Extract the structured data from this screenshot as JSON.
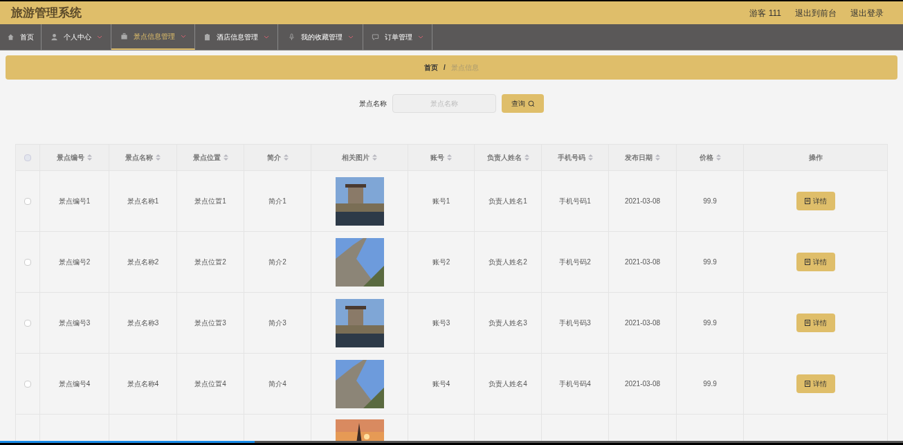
{
  "header": {
    "title": "旅游管理系统",
    "user": "游客 111",
    "links": [
      "退出到前台",
      "退出登录"
    ]
  },
  "nav": [
    {
      "label": "首页",
      "selected": false
    },
    {
      "label": "个人中心",
      "selected": false
    },
    {
      "label": "景点信息管理",
      "selected": true
    },
    {
      "label": "酒店信息管理",
      "selected": false
    },
    {
      "label": "我的收藏管理",
      "selected": false
    },
    {
      "label": "订单管理",
      "selected": false
    }
  ],
  "breadcrumb": {
    "items": [
      "首页",
      "景点信息"
    ],
    "separator": "/"
  },
  "search": {
    "label": "景点名称",
    "placeholder": "景点名称",
    "button": "查询"
  },
  "table": {
    "select_all_checked": false,
    "columns": [
      "景点编号",
      "景点名称",
      "景点位置",
      "简介",
      "相关图片",
      "账号",
      "负责人姓名",
      "手机号码",
      "发布日期",
      "价格",
      "操作"
    ],
    "rows": [
      {
        "checked": false,
        "cells": [
          "景点编号1",
          "景点名称1",
          "景点位置1",
          "简介1",
          "",
          "账号1",
          "负责人姓名1",
          "手机号码1",
          "2021-03-08",
          "99.9"
        ],
        "action": "详情"
      },
      {
        "checked": false,
        "cells": [
          "景点编号2",
          "景点名称2",
          "景点位置2",
          "简介2",
          "",
          "账号2",
          "负责人姓名2",
          "手机号码2",
          "2021-03-08",
          "99.9"
        ],
        "action": "详情"
      },
      {
        "checked": false,
        "cells": [
          "景点编号3",
          "景点名称3",
          "景点位置3",
          "简介3",
          "",
          "账号3",
          "负责人姓名3",
          "手机号码3",
          "2021-03-08",
          "99.9"
        ],
        "action": "详情"
      },
      {
        "checked": false,
        "cells": [
          "景点编号4",
          "景点名称4",
          "景点位置4",
          "简介4",
          "",
          "账号4",
          "负责人姓名4",
          "手机号码4",
          "2021-03-08",
          "99.9"
        ],
        "action": "详情"
      },
      {
        "cells": [
          "",
          "",
          "",
          "",
          "",
          "",
          "",
          "",
          "",
          ""
        ]
      }
    ]
  },
  "playback": {
    "level": 0.282
  }
}
